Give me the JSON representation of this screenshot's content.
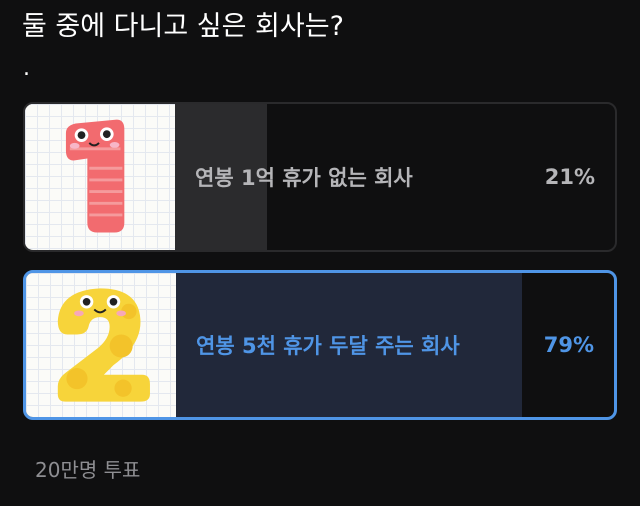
{
  "poll": {
    "question": "둘 중에 다니고 싶은 회사는?",
    "dot": ".",
    "options": [
      {
        "label": "연봉 1억 휴가 없는 회사",
        "percent_text": "21%",
        "percent": 21,
        "image_icon": "number-one-character-icon"
      },
      {
        "label": "연봉 5천 휴가 두달 주는 회사",
        "percent_text": "79%",
        "percent": 79,
        "image_icon": "number-two-character-icon",
        "selected": true
      }
    ],
    "votes": "20만명 투표"
  },
  "colors": {
    "background": "#0f0f10",
    "accent": "#4f95e6",
    "option_fill_default": "#2b2b2d",
    "option_fill_selected": "#21283a",
    "text_muted": "#8e8e92"
  }
}
